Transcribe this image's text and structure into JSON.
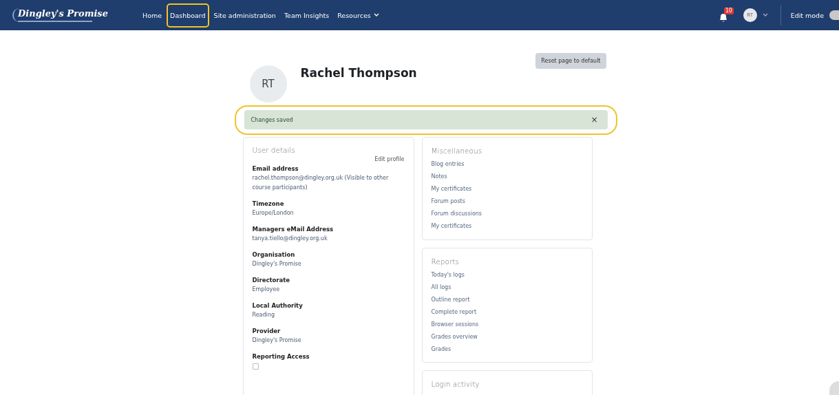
{
  "navbar": {
    "logo": "Dingley's Promise",
    "links": [
      {
        "label": "Home",
        "highlighted": false
      },
      {
        "label": "Dashboard",
        "highlighted": true
      },
      {
        "label": "Site administration",
        "highlighted": false
      },
      {
        "label": "Team Insights",
        "highlighted": false
      },
      {
        "label": "Resources",
        "highlighted": false,
        "dropdown": true
      }
    ],
    "notification_count": "10",
    "avatar": "RT",
    "edit_mode": {
      "label": "Edit mode",
      "on": false
    }
  },
  "header": {
    "reset_button": "Reset page to default",
    "avatar": "RT",
    "name": "Rachel Thompson"
  },
  "alert": {
    "text": "Changes saved",
    "close": "×",
    "highlighted": true
  },
  "user_details": {
    "title": "User details",
    "edit_link": "Edit profile",
    "fields": [
      {
        "label": "Email address",
        "value": "rachel.thompson@dingley.org.uk (Visible to other course participants)"
      },
      {
        "label": "Timezone",
        "value": "Europe/London"
      },
      {
        "label": "Managers eMail Address",
        "value": "tanya.tiello@dingley.org.uk"
      },
      {
        "label": "Organisation",
        "value": "Dingley's Promise"
      },
      {
        "label": "Directorate",
        "value": "Employee"
      },
      {
        "label": "Local Authority",
        "value": "Reading"
      },
      {
        "label": "Provider",
        "value": "Dingley's Promise"
      },
      {
        "label": "Reporting Access",
        "kind": "checkbox",
        "checked": false
      }
    ]
  },
  "side_cards": [
    {
      "title": "Miscellaneous",
      "links": [
        "Blog entries",
        "Notes",
        "My certificates",
        "Forum posts",
        "Forum discussions",
        "My certificates"
      ]
    },
    {
      "title": "Reports",
      "links": [
        "Today's logs",
        "All logs",
        "Outline report",
        "Complete report",
        "Browser sessions",
        "Grades overview",
        "Grades"
      ]
    },
    {
      "title": "Login activity"
    }
  ]
}
